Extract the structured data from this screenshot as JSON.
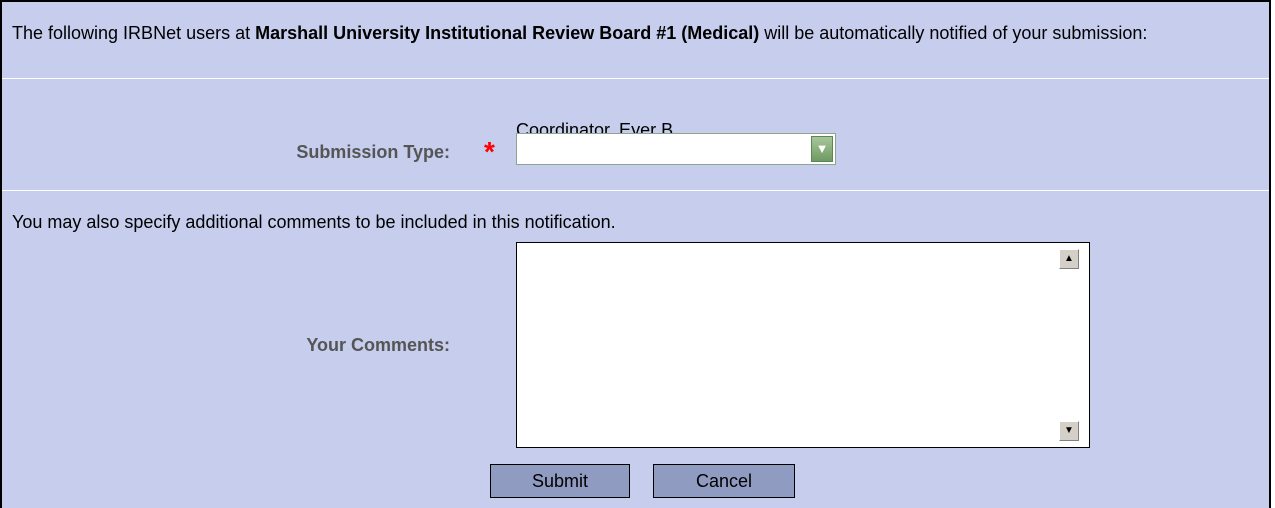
{
  "intro": {
    "before": "The following IRBNet users at ",
    "board": "Marshall University Institutional Review Board #1 (Medical)",
    "after": " will be automatically notified of your submission:"
  },
  "recipient": "Coordinator, Eyer B.",
  "submission_type": {
    "label": "Submission Type:",
    "required_marker": "*",
    "value": ""
  },
  "comments_note": "You may also specify additional comments to be included in this notification.",
  "comments": {
    "label": "Your Comments:",
    "value": ""
  },
  "buttons": {
    "submit": "Submit",
    "cancel": "Cancel"
  },
  "colors": {
    "panel_bg": "#c6cded",
    "button_bg": "#8f9bc0",
    "required": "#ff0000"
  }
}
